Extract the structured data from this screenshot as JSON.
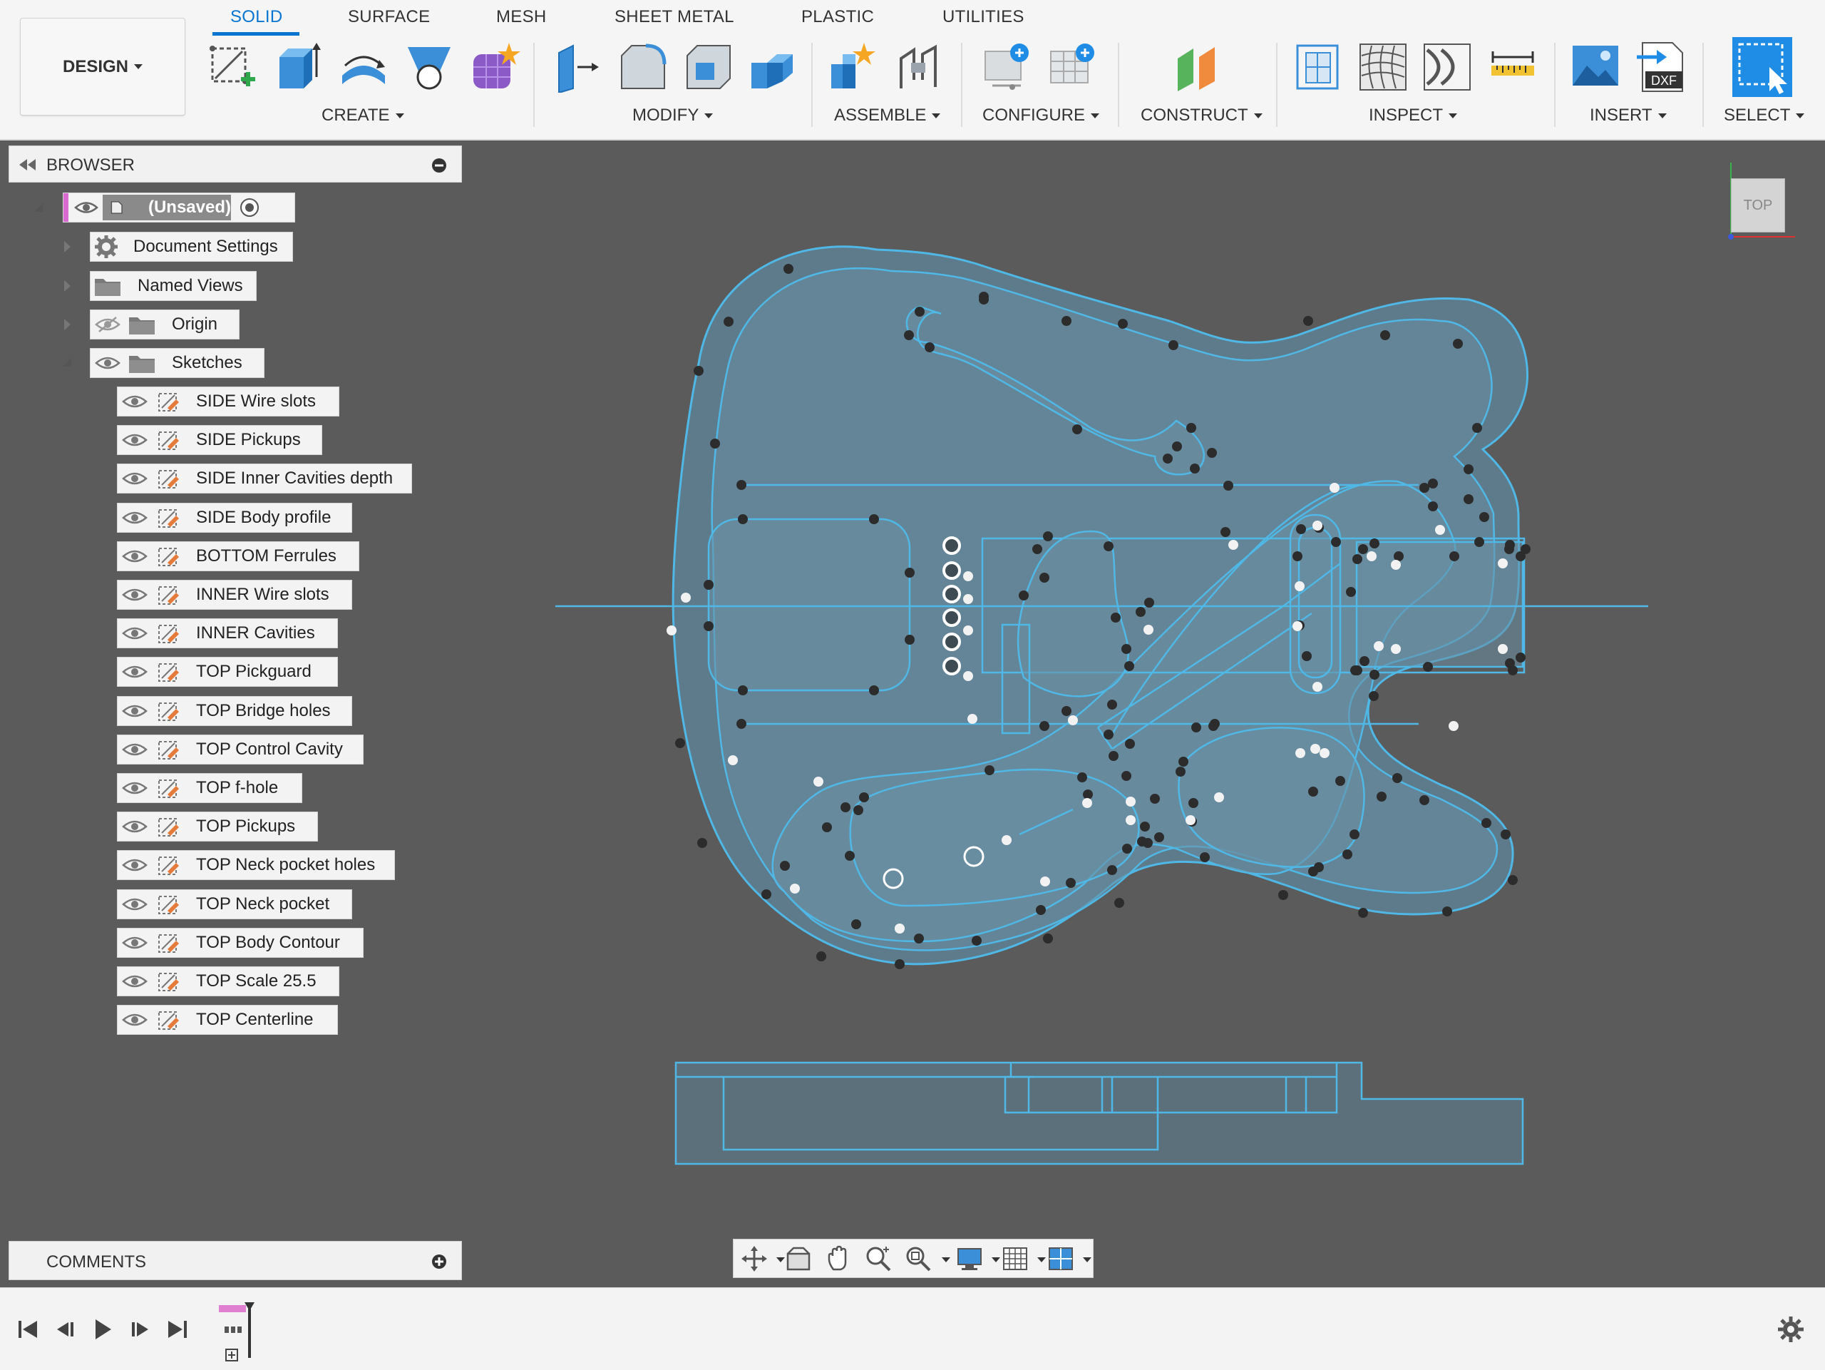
{
  "toolbar": {
    "tabs": [
      {
        "label": "SOLID"
      },
      {
        "label": "SURFACE"
      },
      {
        "label": "MESH"
      },
      {
        "label": "SHEET METAL"
      },
      {
        "label": "PLASTIC"
      },
      {
        "label": "UTILITIES"
      }
    ],
    "active_tab": "SOLID",
    "workspace_label": "DESIGN",
    "groups": {
      "create": "CREATE",
      "modify": "MODIFY",
      "assemble": "ASSEMBLE",
      "configure": "CONFIGURE",
      "construct": "CONSTRUCT",
      "inspect": "INSPECT",
      "insert": "INSERT",
      "select": "SELECT"
    },
    "dxf_badge": "DXF"
  },
  "browser": {
    "title": "BROWSER",
    "root": "(Unsaved)",
    "folders": [
      {
        "label": "Document Settings"
      },
      {
        "label": "Named Views"
      },
      {
        "label": "Origin"
      },
      {
        "label": "Sketches"
      }
    ],
    "sketches": [
      {
        "label": "SIDE Wire slots"
      },
      {
        "label": "SIDE Pickups"
      },
      {
        "label": "SIDE Inner Cavities depth"
      },
      {
        "label": "SIDE Body profile"
      },
      {
        "label": "BOTTOM Ferrules"
      },
      {
        "label": "INNER Wire slots"
      },
      {
        "label": "INNER Cavities"
      },
      {
        "label": "TOP Pickguard"
      },
      {
        "label": "TOP Bridge holes"
      },
      {
        "label": "TOP Control Cavity"
      },
      {
        "label": "TOP f-hole"
      },
      {
        "label": "TOP Pickups"
      },
      {
        "label": "TOP Neck pocket holes"
      },
      {
        "label": "TOP Neck pocket"
      },
      {
        "label": "TOP Body Contour"
      },
      {
        "label": "TOP Scale 25.5"
      },
      {
        "label": "TOP Centerline"
      }
    ]
  },
  "comments": {
    "title": "COMMENTS"
  },
  "viewcube": {
    "face": "TOP"
  },
  "colors": {
    "sketch_line": "#4fb8e6",
    "sketch_fill": "#5d7f93",
    "canvas": "#5b5b5b",
    "accent": "#0a74d1",
    "timeline_marker": "#e07fd0"
  }
}
